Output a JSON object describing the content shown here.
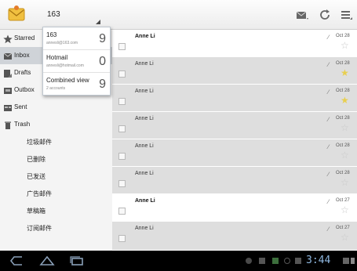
{
  "action_bar": {
    "account_name": "163",
    "icons": [
      "envelope-icon",
      "compose-icon",
      "refresh-icon",
      "menu-icon"
    ]
  },
  "account_dropdown": [
    {
      "name": "163",
      "address": "annesli@163.com",
      "count": "9"
    },
    {
      "name": "Hotmail",
      "address": "annesli@hotmail.com",
      "count": "0"
    },
    {
      "name": "Combined view",
      "address": "2 accounts",
      "count": "9"
    }
  ],
  "folders": [
    {
      "label": "Starred",
      "icon": "star-icon"
    },
    {
      "label": "Inbox",
      "icon": "inbox-icon",
      "selected": true
    },
    {
      "label": "Drafts",
      "icon": "drafts-icon"
    },
    {
      "label": "Outbox",
      "icon": "outbox-icon"
    },
    {
      "label": "Sent",
      "icon": "sent-icon"
    },
    {
      "label": "Trash",
      "icon": "trash-icon"
    },
    {
      "label": "垃圾邮件"
    },
    {
      "label": "已删除"
    },
    {
      "label": "已发送"
    },
    {
      "label": "广告邮件"
    },
    {
      "label": "草稿箱"
    },
    {
      "label": "订阅邮件"
    }
  ],
  "messages": [
    {
      "sender": "Anne Li",
      "date": "Oct 28",
      "unread": true,
      "starred": false
    },
    {
      "sender": "Anne Li",
      "date": "Oct 28",
      "unread": false,
      "starred": true
    },
    {
      "sender": "Anne Li",
      "date": "Oct 28",
      "unread": false,
      "starred": true
    },
    {
      "sender": "Anne Li",
      "date": "Oct 28",
      "unread": false,
      "starred": false
    },
    {
      "sender": "Anne Li",
      "date": "Oct 28",
      "unread": false,
      "starred": false
    },
    {
      "sender": "Anne Li",
      "date": "Oct 28",
      "unread": false,
      "starred": false
    },
    {
      "sender": "Anne Li",
      "date": "Oct 27",
      "unread": true,
      "starred": false
    },
    {
      "sender": "Anne Li",
      "date": "Oct 27",
      "unread": false,
      "starred": false
    }
  ],
  "system_bar": {
    "clock": "3:44",
    "nav_icons": [
      "back-icon",
      "home-icon",
      "recent-apps-icon"
    ]
  },
  "colors": {
    "selected_folder": "#cfd3d8",
    "read_row": "#dedede",
    "star_gold": "#e8cf4f",
    "clock": "#8fb8e0"
  }
}
